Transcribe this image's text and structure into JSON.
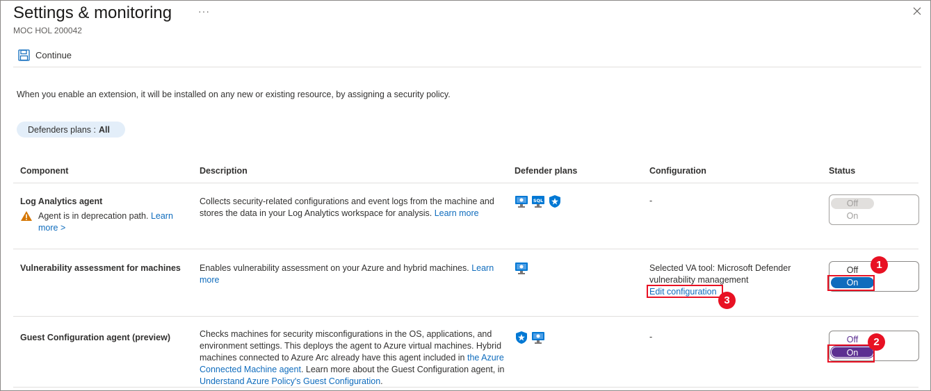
{
  "header": {
    "title": "Settings & monitoring",
    "more_label": "···",
    "subtitle": "MOC HOL 200042",
    "close_icon": "close-icon"
  },
  "toolbar": {
    "continue_label": "Continue",
    "continue_icon": "save-icon"
  },
  "intro_text": "When you enable an extension, it will be installed on any new or existing resource, by assigning a security policy.",
  "filter": {
    "label": "Defenders plans :",
    "value": "All"
  },
  "table": {
    "headers": {
      "component": "Component",
      "description": "Description",
      "plans": "Defender plans",
      "configuration": "Configuration",
      "status": "Status"
    },
    "rows": [
      {
        "component": "Log Analytics agent",
        "warning_text": "Agent is in deprecation path.",
        "warning_link": "Learn more >",
        "description": "Collects security-related configurations and event logs from the machine and stores the data in your Log Analytics workspace for analysis.",
        "description_link": "Learn more",
        "plan_icons": [
          "server-icon",
          "sql-icon",
          "shield-star-icon"
        ],
        "configuration": "-",
        "status": {
          "off": "Off",
          "on": "On",
          "selected": "Off",
          "disabled": true
        }
      },
      {
        "component": "Vulnerability assessment for machines",
        "description": "Enables vulnerability assessment on your Azure and hybrid machines.",
        "description_link": "Learn more",
        "plan_icons": [
          "server-icon"
        ],
        "config_label": "Selected VA tool:",
        "config_value": "Microsoft Defender vulnerability management",
        "config_link": "Edit configuration",
        "status": {
          "off": "Off",
          "on": "On",
          "selected": "On",
          "disabled": false
        }
      },
      {
        "component": "Guest Configuration agent (preview)",
        "description": "Checks machines for security misconfigurations in the OS, applications, and environment settings. This deploys the agent to Azure virtual machines. Hybrid machines connected to Azure Arc already have this agent included in",
        "description_link1": "the Azure Connected Machine agent",
        "description_mid": ". Learn more about the Guest Configuration agent, in",
        "description_link2": "Understand Azure Policy's Guest Configuration",
        "description_end": ".",
        "plan_icons": [
          "shield-star-icon",
          "server-icon"
        ],
        "configuration": "-",
        "status": {
          "off": "Off",
          "on": "On",
          "selected": "On",
          "disabled": false
        }
      }
    ]
  },
  "annotations": [
    "1",
    "2",
    "3"
  ],
  "colors": {
    "link": "#0f6cbd",
    "annotation_red": "#e81123",
    "toggle_blue": "#0f6cbd",
    "toggle_purple": "#5c2e91",
    "pill_bg": "#e3eef9"
  }
}
